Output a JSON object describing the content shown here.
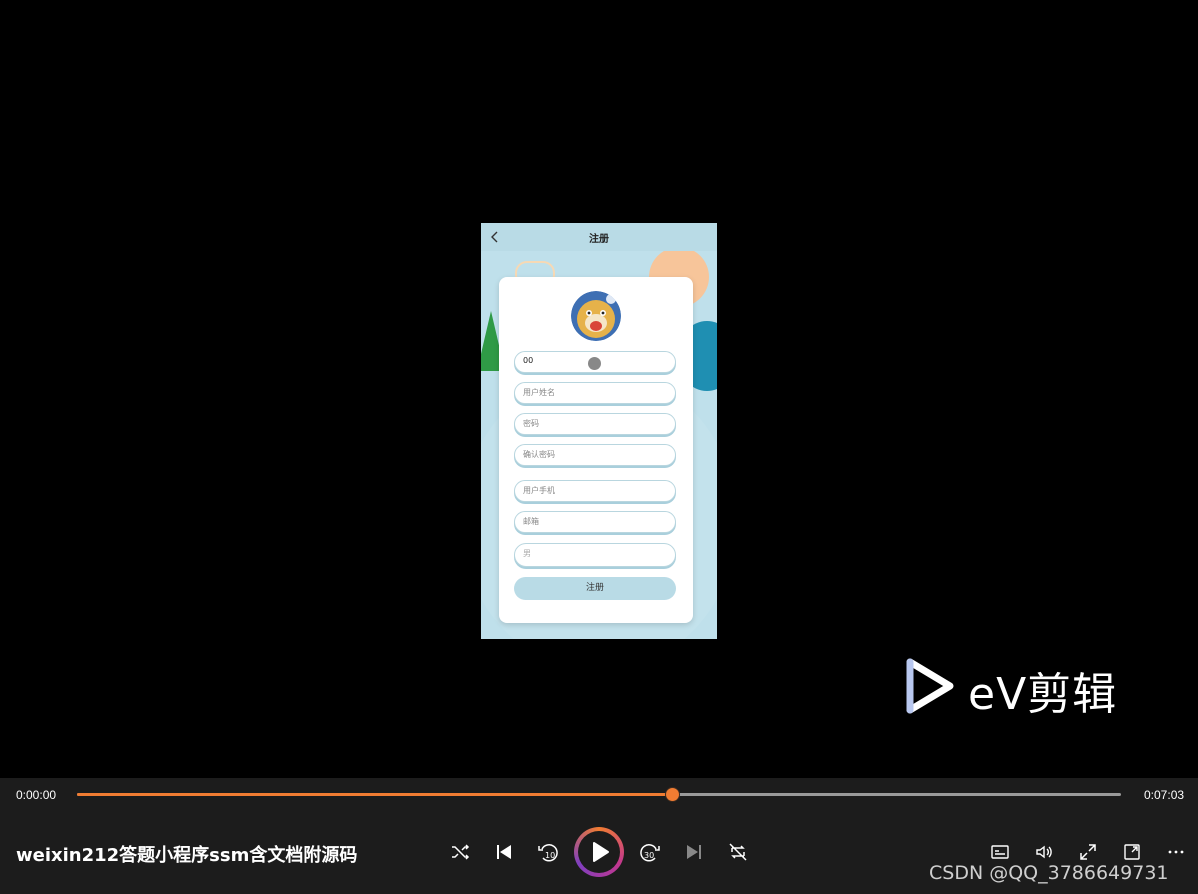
{
  "phone": {
    "title": "注册",
    "fields": [
      {
        "value": "00",
        "placeholder": ""
      },
      {
        "value": "",
        "placeholder": "用户姓名"
      },
      {
        "value": "",
        "placeholder": "密码"
      },
      {
        "value": "",
        "placeholder": "确认密码"
      },
      {
        "value": "",
        "placeholder": "用户手机"
      },
      {
        "value": "",
        "placeholder": "邮箱"
      },
      {
        "value": "",
        "placeholder": "男"
      }
    ],
    "submit_label": "注册"
  },
  "logo": {
    "text": "eV剪辑"
  },
  "player": {
    "current_time": "0:00:00",
    "total_time": "0:07:03",
    "progress": 0.57,
    "title": "weixin212答题小程序ssm含文档附源码",
    "accent_color": "#f07c32"
  },
  "watermark": "CSDN @QQ_3786649731"
}
